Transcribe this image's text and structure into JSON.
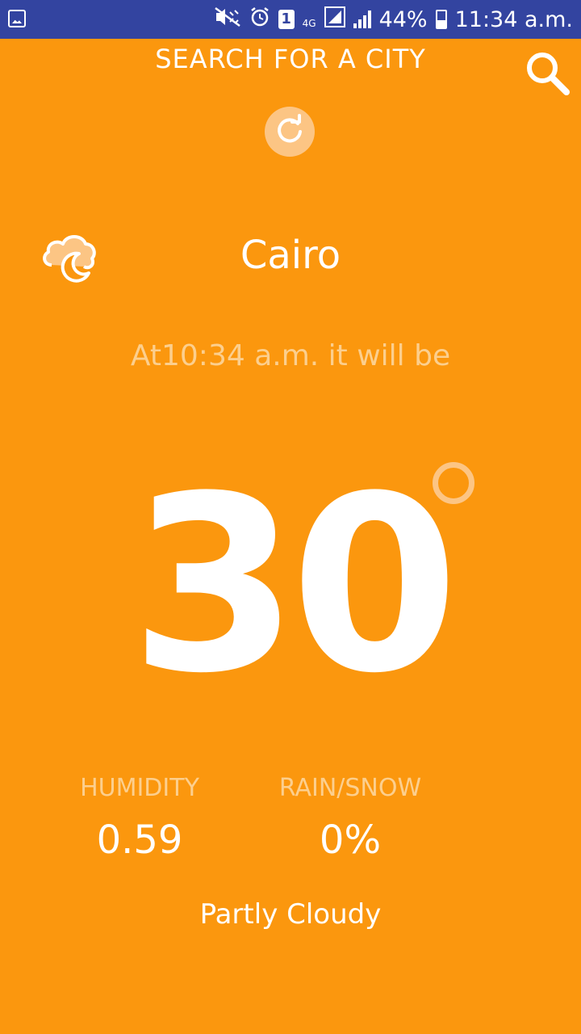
{
  "status_bar": {
    "left_icon": "gallery-icon",
    "icons": [
      "mute-vibrate-icon",
      "alarm-icon",
      "sim1-icon",
      "4g-icon",
      "signal-icon",
      "signal-icon",
      "battery-icon"
    ],
    "sim_badge": "1",
    "network": "4G",
    "battery": "44%",
    "time": "11:34 a.m."
  },
  "header": {
    "title": "SEARCH FOR A CITY",
    "search_icon": "search-icon",
    "refresh_icon": "refresh-icon"
  },
  "weather": {
    "icon": "partly-cloudy-night-icon",
    "city": "Cairo",
    "forecast_text": "At10:34 a.m. it will be",
    "temperature": "30",
    "humidity_label": "HUMIDITY",
    "humidity_value": "0.59",
    "precip_label": "RAIN/SNOW",
    "precip_value": "0%",
    "condition": "Partly Cloudy"
  },
  "colors": {
    "background": "#FB970E",
    "status_bar": "#3344A0",
    "accent_light": "#FCC584",
    "text_muted": "#FCCF8E",
    "text": "#FFFFFF"
  }
}
